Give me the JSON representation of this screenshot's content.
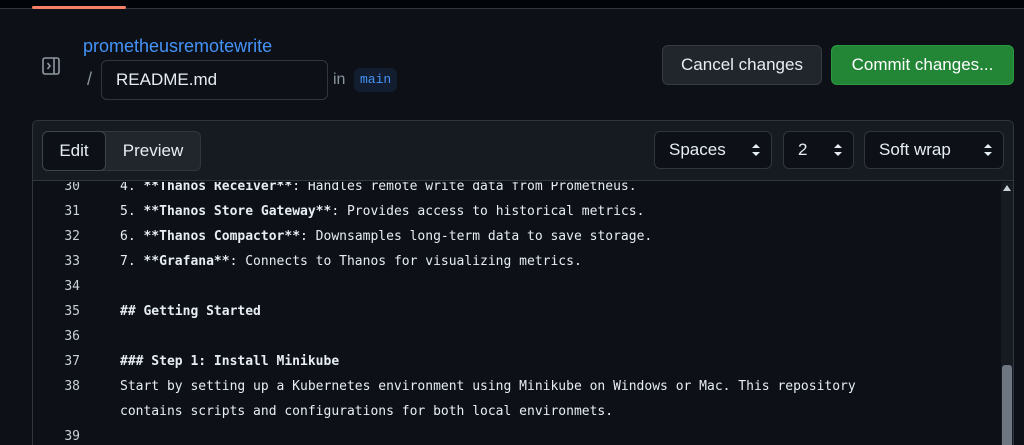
{
  "header": {
    "repo_name": "prometheusremotewrite",
    "path_separator": "/",
    "filename_value": "README.md",
    "in_label": "in",
    "branch": "main",
    "cancel_label": "Cancel changes",
    "commit_label": "Commit changes..."
  },
  "toolbar": {
    "tabs": [
      {
        "label": "Edit",
        "selected": true
      },
      {
        "label": "Preview",
        "selected": false
      }
    ],
    "indent_mode": "Spaces",
    "indent_size": "2",
    "wrap_mode": "Soft wrap"
  },
  "editor": {
    "lines": [
      {
        "num": "30",
        "text": "4. **Thanos Receiver**: Handles remote write data from Prometheus.",
        "bold": "**Thanos Receiver**",
        "pre": "4. ",
        "post": ": Handles remote write data from Prometheus."
      },
      {
        "num": "31",
        "pre": "5. ",
        "bold": "**Thanos Store Gateway**",
        "post": ": Provides access to historical metrics."
      },
      {
        "num": "32",
        "pre": "6. ",
        "bold": "**Thanos Compactor**",
        "post": ": Downsamples long-term data to save storage."
      },
      {
        "num": "33",
        "pre": "7. ",
        "bold": "**Grafana**",
        "post": ": Connects to Thanos for visualizing metrics."
      },
      {
        "num": "34",
        "pre": "",
        "bold": "",
        "post": ""
      },
      {
        "num": "35",
        "pre": "",
        "bold": "## Getting Started",
        "post": ""
      },
      {
        "num": "36",
        "pre": "",
        "bold": "",
        "post": ""
      },
      {
        "num": "37",
        "pre": "",
        "bold": "### Step 1: Install Minikube",
        "post": ""
      },
      {
        "num": "38",
        "pre": "Start by setting up a Kubernetes environment using Minikube on Windows or Mac. This repository",
        "bold": "",
        "post": ""
      },
      {
        "num": "",
        "pre": "contains scripts and configurations for both local environmets.",
        "bold": "",
        "post": ""
      },
      {
        "num": "39",
        "pre": "",
        "bold": "",
        "post": ""
      }
    ]
  },
  "colors": {
    "accent_link": "#4493f8",
    "commit_green": "#238636",
    "background": "#0d1117"
  }
}
